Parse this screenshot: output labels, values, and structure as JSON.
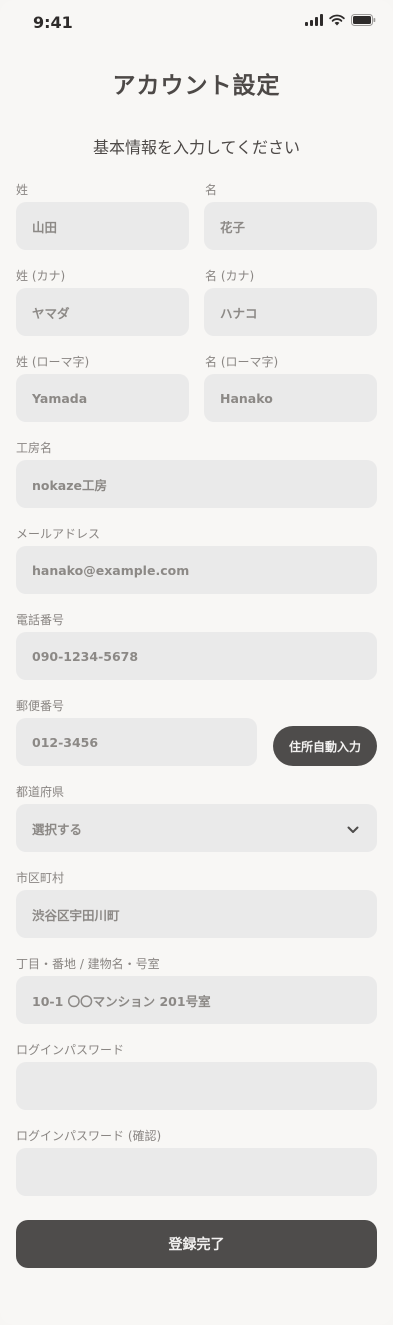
{
  "status_bar": {
    "time": "9:41"
  },
  "header": {
    "title": "アカウント設定",
    "subtitle": "基本情報を入力してください"
  },
  "form": {
    "last_name": {
      "label": "姓",
      "value": "山田"
    },
    "first_name": {
      "label": "名",
      "value": "花子"
    },
    "last_name_kana": {
      "label": "姓 (カナ)",
      "value": "ヤマダ"
    },
    "first_name_kana": {
      "label": "名 (カナ)",
      "value": "ハナコ"
    },
    "last_name_roma": {
      "label": "姓 (ローマ字)",
      "value": "Yamada"
    },
    "first_name_roma": {
      "label": "名 (ローマ字)",
      "value": "Hanako"
    },
    "studio": {
      "label": "工房名",
      "value": "nokaze工房"
    },
    "email": {
      "label": "メールアドレス",
      "value": "hanako@example.com"
    },
    "phone": {
      "label": "電話番号",
      "value": "090-1234-5678"
    },
    "postal": {
      "label": "郵便番号",
      "value": "012-3456",
      "auto_button": "住所自動入力"
    },
    "prefecture": {
      "label": "都道府県",
      "value": "選択する"
    },
    "city": {
      "label": "市区町村",
      "value": "渋谷区宇田川町"
    },
    "address": {
      "label": "丁目・番地 / 建物名・号室",
      "value": "10-1 〇〇マンション 201号室"
    },
    "password": {
      "label": "ログインパスワード",
      "value": ""
    },
    "password_confirm": {
      "label": "ログインパスワード (確認)",
      "value": ""
    },
    "submit_label": "登録完了"
  },
  "icons": {
    "select": "chevron-down-icon"
  },
  "colors": {
    "background": "#f8f7f5",
    "field": "#eaeaea",
    "button": "#4e4c4b"
  }
}
